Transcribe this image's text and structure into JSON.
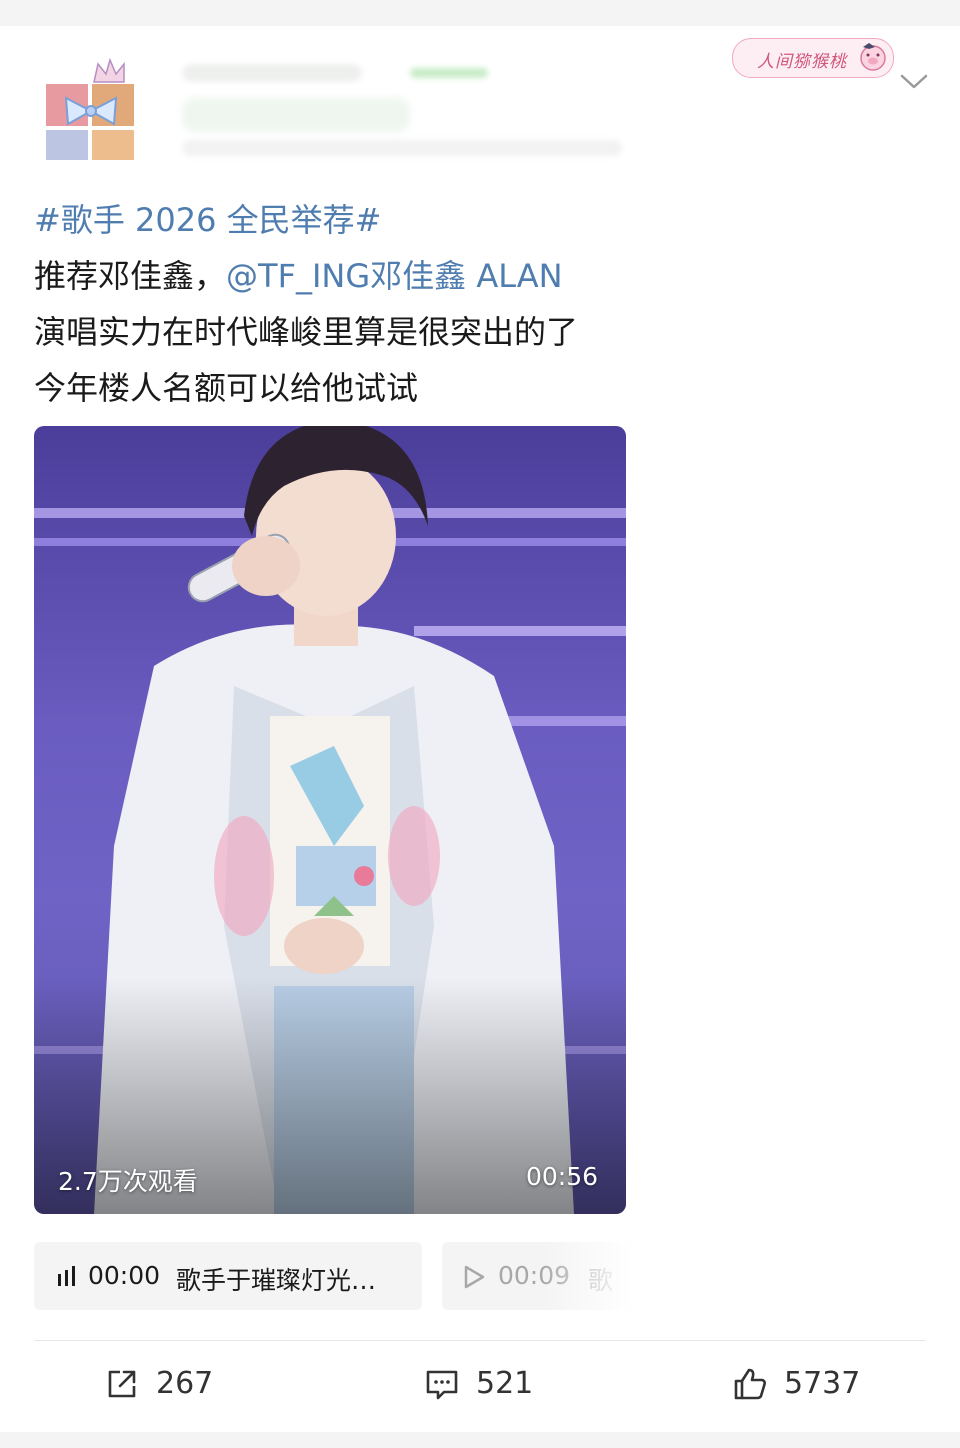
{
  "post": {
    "hashtag": "#歌手 2026 全民举荐#",
    "line2_prefix": "推荐邓佳鑫，",
    "mention": "@TF_ING邓佳鑫 ALAN",
    "line3": "演唱实力在时代峰峻里算是很突出的了",
    "line4": "今年楼人名额可以给他试试"
  },
  "header": {
    "sticker_text": "人间猕猴桃",
    "menu_icon": "chevron-down-icon"
  },
  "video": {
    "views": "2.7万次观看",
    "duration": "00:56"
  },
  "chapters": [
    {
      "time": "00:00",
      "title": "歌手于璀璨灯光…",
      "icon": "audio-bars-icon"
    },
    {
      "time": "00:09",
      "title": "歌",
      "icon": "play-icon"
    }
  ],
  "actions": {
    "repost_count": "267",
    "comment_count": "521",
    "like_count": "5737"
  },
  "colors": {
    "link": "#507daf",
    "text": "#1a1a1a",
    "chip_bg": "#f4f4f4"
  }
}
